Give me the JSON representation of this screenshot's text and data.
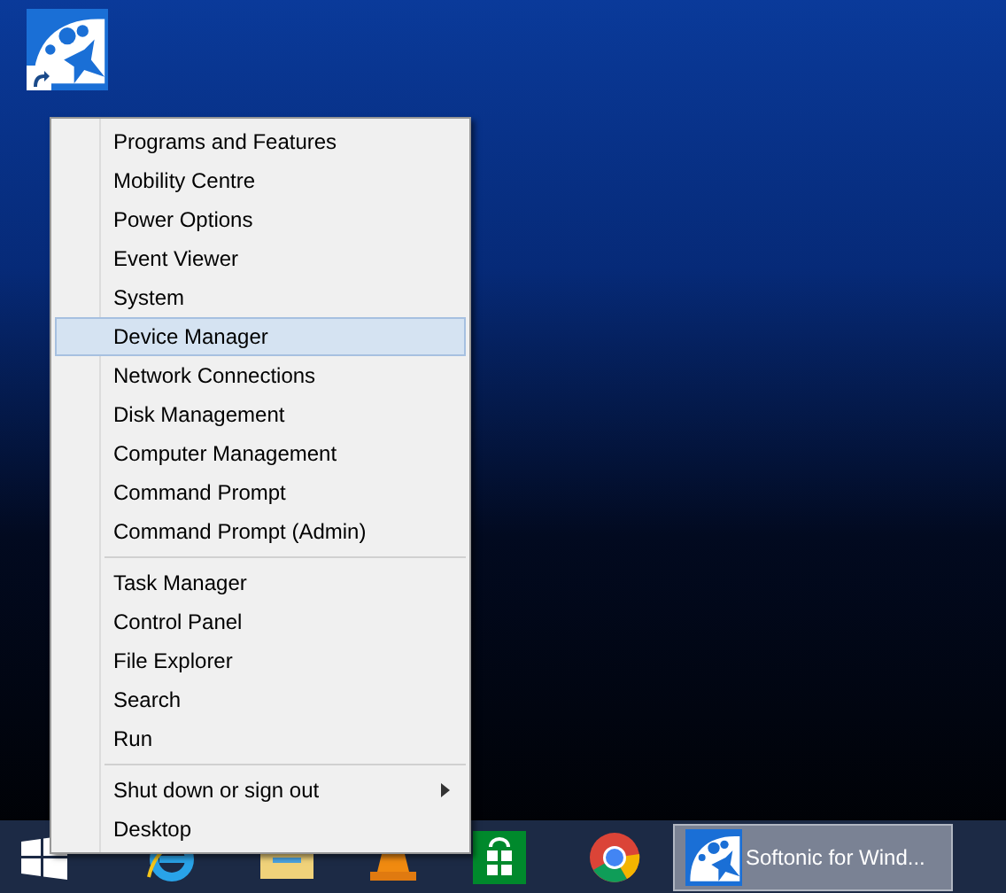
{
  "context_menu": {
    "groups": [
      [
        {
          "label": "Programs and Features",
          "selected": false,
          "submenu": false
        },
        {
          "label": "Mobility Centre",
          "selected": false,
          "submenu": false
        },
        {
          "label": "Power Options",
          "selected": false,
          "submenu": false
        },
        {
          "label": "Event Viewer",
          "selected": false,
          "submenu": false
        },
        {
          "label": "System",
          "selected": false,
          "submenu": false
        },
        {
          "label": "Device Manager",
          "selected": true,
          "submenu": false
        },
        {
          "label": "Network Connections",
          "selected": false,
          "submenu": false
        },
        {
          "label": "Disk Management",
          "selected": false,
          "submenu": false
        },
        {
          "label": "Computer Management",
          "selected": false,
          "submenu": false
        },
        {
          "label": "Command Prompt",
          "selected": false,
          "submenu": false
        },
        {
          "label": "Command Prompt (Admin)",
          "selected": false,
          "submenu": false
        }
      ],
      [
        {
          "label": "Task Manager",
          "selected": false,
          "submenu": false
        },
        {
          "label": "Control Panel",
          "selected": false,
          "submenu": false
        },
        {
          "label": "File Explorer",
          "selected": false,
          "submenu": false
        },
        {
          "label": "Search",
          "selected": false,
          "submenu": false
        },
        {
          "label": "Run",
          "selected": false,
          "submenu": false
        }
      ],
      [
        {
          "label": "Shut down or sign out",
          "selected": false,
          "submenu": true
        },
        {
          "label": "Desktop",
          "selected": false,
          "submenu": false
        }
      ]
    ]
  },
  "taskbar": {
    "window_button": {
      "label": "Softonic for Wind...",
      "selected": true
    }
  }
}
